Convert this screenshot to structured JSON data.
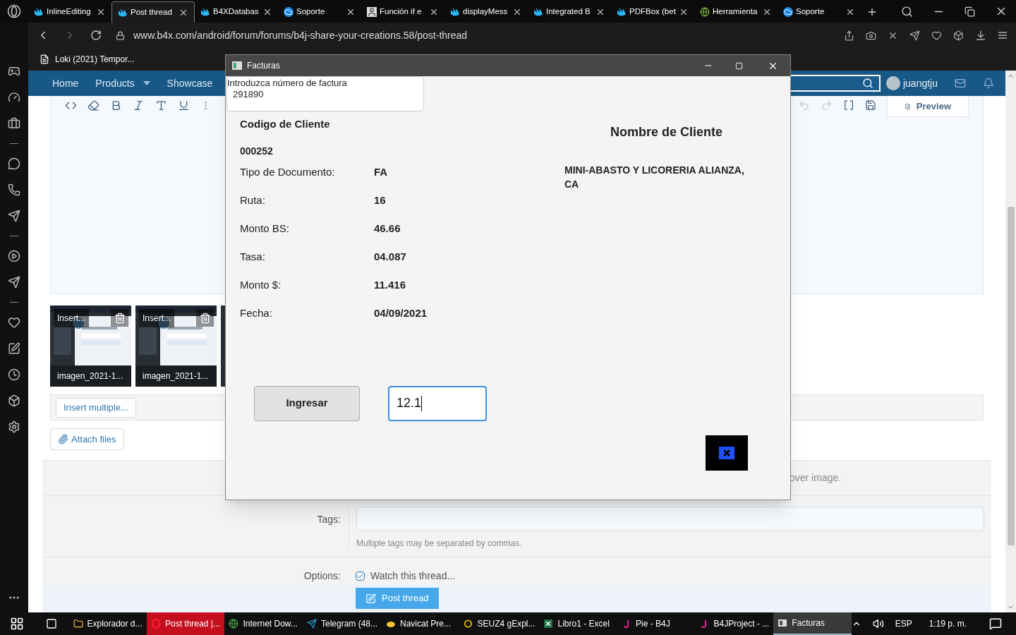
{
  "browser": {
    "tabs": [
      {
        "title": "InlineEditing",
        "selected": false
      },
      {
        "title": "Post thread",
        "selected": true
      },
      {
        "title": "B4XDatabas",
        "selected": false
      },
      {
        "title": "Soporte",
        "selected": false
      },
      {
        "title": "Función if e",
        "selected": false
      },
      {
        "title": "displayMess",
        "selected": false
      },
      {
        "title": "Integrated B",
        "selected": false
      },
      {
        "title": "PDFBox (bet",
        "selected": false
      },
      {
        "title": "Herramienta",
        "selected": false
      },
      {
        "title": "Soporte",
        "selected": false
      }
    ],
    "address": "www.b4x.com/android/forum/forums/b4j-share-your-creations.58/post-thread",
    "bookmarks": [
      "Loki (2021) Tempor..."
    ]
  },
  "forum": {
    "nav": [
      {
        "label": "Home",
        "dropdown": false
      },
      {
        "label": "Products",
        "dropdown": true
      },
      {
        "label": "Showcase",
        "dropdown": false
      }
    ],
    "user": "juangtju",
    "preview": "Preview",
    "attachments": [
      {
        "action": "Insert...",
        "name": "imagen_2021-1..."
      },
      {
        "action": "Insert...",
        "name": "imagen_2021-1..."
      }
    ],
    "insert_multiple": "Insert multiple...",
    "attach_files": "Attach files",
    "hint_fragment": "over image.",
    "tags_label": "Tags:",
    "tags_hint": "Multiple tags may be separated by commas.",
    "options_label": "Options:",
    "watch": {
      "label": "Watch this thread...",
      "checked": true
    },
    "post_button": "Post thread"
  },
  "dialog": {
    "title": "Facturas",
    "invoice_field": {
      "label": "Introduzca número de factura",
      "value": "291890"
    },
    "client_code_label": "Codigo de Cliente",
    "client_code": "000252",
    "client_name_label": "Nombre de Cliente",
    "client_name": "MINI-ABASTO Y LICORERIA ALIANZA, CA",
    "fields": [
      {
        "label": "Tipo de Documento:",
        "value": "FA"
      },
      {
        "label": "Ruta:",
        "value": "16"
      },
      {
        "label": "Monto BS:",
        "value": "46.66"
      },
      {
        "label": "Tasa:",
        "value": "04.087"
      },
      {
        "label": "Monto $:",
        "value": "11.416"
      },
      {
        "label": "Fecha:",
        "value": "04/09/2021"
      }
    ],
    "submit": "Ingresar",
    "amount": "12.1"
  },
  "taskbar": {
    "items": [
      {
        "label": "Explorador d...",
        "selected": false,
        "attention": false
      },
      {
        "label": "Post thread |...",
        "selected": false,
        "attention": true
      },
      {
        "label": "Internet Dow...",
        "selected": false,
        "attention": false
      },
      {
        "label": "Telegram (48...",
        "selected": false,
        "attention": false
      },
      {
        "label": "Navicat Pre...",
        "selected": false,
        "attention": false
      },
      {
        "label": "SEUZ4 gExpl...",
        "selected": false,
        "attention": false
      },
      {
        "label": "Libro1 - Excel",
        "selected": false,
        "attention": false
      },
      {
        "label": "Pie - B4J",
        "selected": false,
        "attention": false
      },
      {
        "label": "B4JProject - ...",
        "selected": false,
        "attention": false
      },
      {
        "label": "Facturas",
        "selected": true,
        "attention": false
      }
    ],
    "language": "ESP",
    "time": "1:19 p. m."
  }
}
